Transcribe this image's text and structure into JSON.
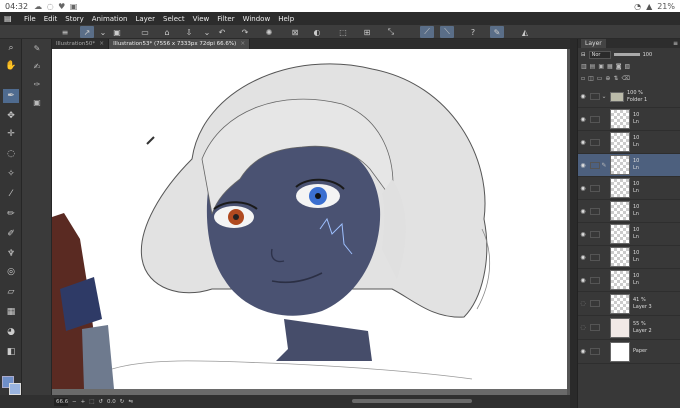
{
  "statusbar": {
    "time": "04:32",
    "notif_icons": "☁ ◌ ♥ ▣",
    "battery": "21%"
  },
  "menubar": {
    "items": [
      "File",
      "Edit",
      "Story",
      "Animation",
      "Layer",
      "Select",
      "View",
      "Filter",
      "Window",
      "Help"
    ]
  },
  "tabs": [
    {
      "label": "Illustration50*"
    },
    {
      "label": "Illustration53* (7556 x 7333px 72dpi 66.6%)"
    }
  ],
  "bottombar": {
    "zoom": "66.6",
    "angle": "0.0"
  },
  "layer_panel": {
    "title": "Layer",
    "blend_mode": "Nor",
    "opacity": "100",
    "layers": [
      {
        "opacity": "100 %",
        "name": "Folder 1",
        "kind": "folder"
      },
      {
        "opacity": "10",
        "name": "Ln",
        "kind": "raster"
      },
      {
        "opacity": "10",
        "name": "Ln",
        "kind": "raster"
      },
      {
        "opacity": "10",
        "name": "Ln",
        "kind": "raster",
        "selected": true
      },
      {
        "opacity": "10",
        "name": "Ln",
        "kind": "raster"
      },
      {
        "opacity": "10",
        "name": "Ln",
        "kind": "raster"
      },
      {
        "opacity": "10",
        "name": "Ln",
        "kind": "raster"
      },
      {
        "opacity": "10",
        "name": "Ln",
        "kind": "raster"
      },
      {
        "opacity": "10",
        "name": "Ln",
        "kind": "raster"
      },
      {
        "opacity": "41 %",
        "name": "Layer 3",
        "kind": "raster"
      },
      {
        "opacity": "55 %",
        "name": "Layer 2",
        "kind": "raster"
      },
      {
        "opacity": "",
        "name": "Paper",
        "kind": "paper"
      }
    ]
  },
  "colors": {
    "main": "#6f8fc8",
    "sub": "#9ab4e0",
    "accent": "#4f6b8f"
  }
}
